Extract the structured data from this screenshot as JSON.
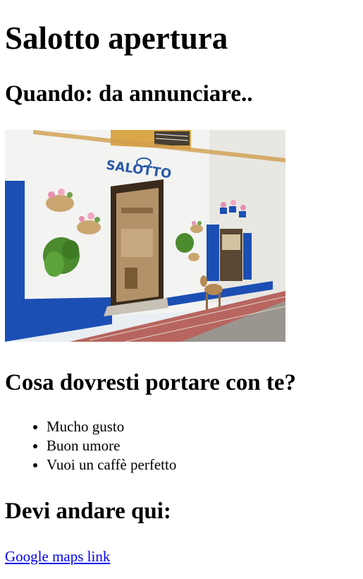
{
  "title": "Salotto apertura",
  "when_heading": "Quando: da annunciare..",
  "photo": {
    "sign_text": "SALOTTO",
    "colors": {
      "wall": "#f3f3f1",
      "blue_trim": "#1c4fb4",
      "paving": "#b8655f",
      "cobbles": "#9a958e"
    }
  },
  "bring_heading": "Cosa dovresti portare con te?",
  "bring_items": [
    "Mucho gusto",
    "Buon umore",
    "Vuoi un caffè perfetto"
  ],
  "where_heading": "Devi andare qui:",
  "maps_link": "Google maps link",
  "link_color": "#0000ee"
}
